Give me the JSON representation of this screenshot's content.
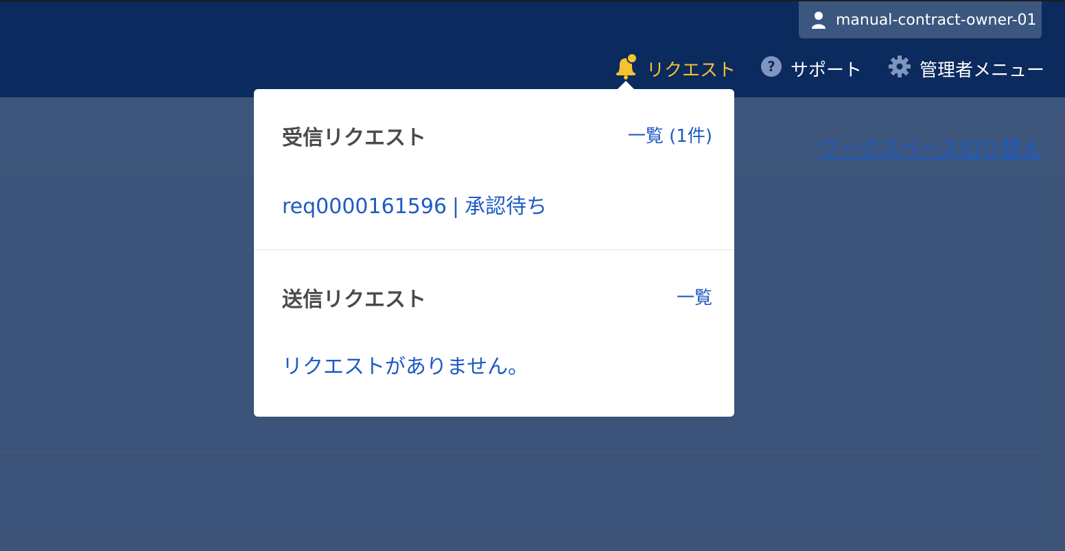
{
  "header": {
    "user_name": "manual-contract-owner-01",
    "nav": {
      "request_label": "リクエスト",
      "support_label": "サポート",
      "admin_label": "管理者メニュー"
    }
  },
  "workspace_switch_label": "ワークスペース切り替え",
  "dropdown": {
    "received": {
      "title": "受信リクエスト",
      "list_link": "一覧 (1件)",
      "item": {
        "id": "req0000161596",
        "separator": "|",
        "status": "承認待ち"
      }
    },
    "sent": {
      "title": "送信リクエスト",
      "list_link": "一覧",
      "empty_message": "リクエストがありません。"
    }
  },
  "colors": {
    "header_bg": "#0b2a5e",
    "accent_yellow": "#f5c230",
    "link_blue": "#1e5bc4"
  }
}
